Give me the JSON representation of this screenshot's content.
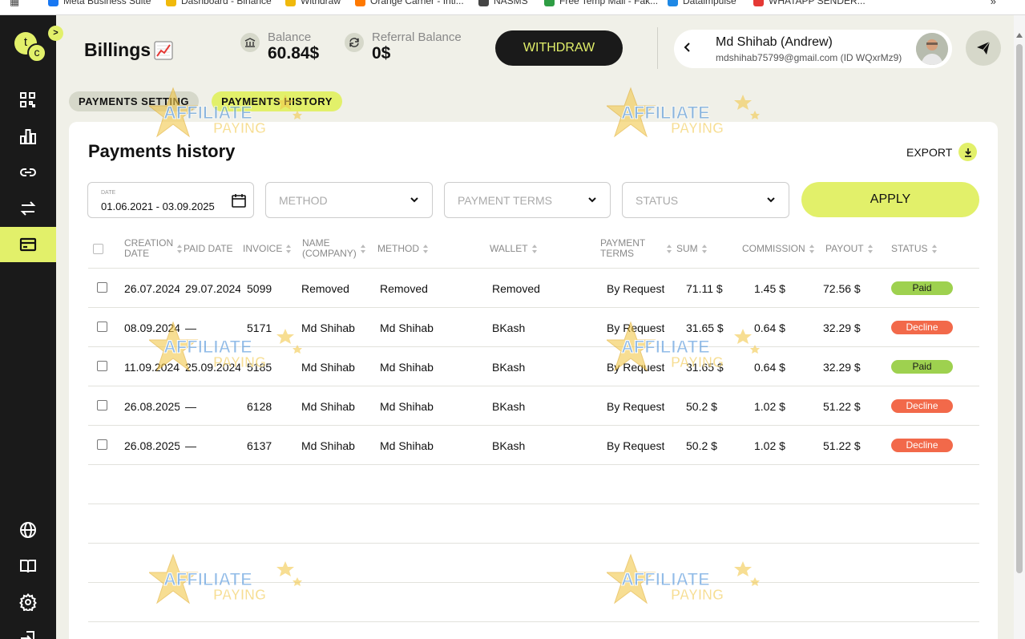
{
  "bookmarks": [
    {
      "label": "Meta Business Suite",
      "color": "#1877f2"
    },
    {
      "label": "Dashboard - Binance",
      "color": "#f0b90b"
    },
    {
      "label": "Withdraw",
      "color": "#f0b90b"
    },
    {
      "label": "Orange Carrier - Intl...",
      "color": "#ff7900"
    },
    {
      "label": "NASMS",
      "color": "#444444"
    },
    {
      "label": "Free Temp Mail - Fak...",
      "color": "#2e9d44"
    },
    {
      "label": "Dataimpulse",
      "color": "#1e88e5"
    },
    {
      "label": "WHATAPP SENDER...",
      "color": "#e53935"
    }
  ],
  "bookmarks_more": "»",
  "logo": {
    "t": "t",
    "c": "c"
  },
  "sidebar": {
    "collapse_glyph": ">",
    "items": [
      {
        "icon": "grid-icon",
        "active": false
      },
      {
        "icon": "bar-chart-icon",
        "active": false
      },
      {
        "icon": "link-icon",
        "active": false
      },
      {
        "icon": "swap-icon",
        "active": false
      },
      {
        "icon": "credit-card-icon",
        "active": true
      },
      {
        "icon": "globe-icon",
        "active": false
      },
      {
        "icon": "book-icon",
        "active": false
      },
      {
        "icon": "gear-icon",
        "active": false
      },
      {
        "icon": "logout-icon",
        "active": false
      }
    ]
  },
  "header": {
    "title": "Billings",
    "balance_label": "Balance",
    "balance_value": "60.84$",
    "referral_label": "Referral Balance",
    "referral_value": "0$",
    "withdraw_label": "WITHDRAW"
  },
  "user": {
    "name": "Md Shihab (Andrew)",
    "email": "mdshihab75799@gmail.com (ID WQxrMz9)"
  },
  "tabs": [
    {
      "label": "PAYMENTS SETTING",
      "active": false
    },
    {
      "label": "PAYMENTS HISTORY",
      "active": true
    }
  ],
  "panel": {
    "title": "Payments history",
    "export_label": "EXPORT"
  },
  "filters": {
    "date_label": "DATE",
    "date_value": "01.06.2021 - 03.09.2025",
    "method_placeholder": "METHOD",
    "terms_placeholder": "PAYMENT TERMS",
    "status_placeholder": "STATUS",
    "apply_label": "APPLY"
  },
  "table": {
    "columns": [
      {
        "label": "CREATION DATE",
        "lines": [
          "CREATION",
          "DATE"
        ],
        "sortable": true
      },
      {
        "label": "PAID DATE",
        "lines": [
          "PAID DATE"
        ],
        "sortable": false
      },
      {
        "label": "INVOICE",
        "lines": [
          "INVOICE"
        ],
        "sortable": true
      },
      {
        "label": "NAME (COMPANY)",
        "lines": [
          "NAME",
          "(COMPANY)"
        ],
        "sortable": true
      },
      {
        "label": "METHOD",
        "lines": [
          "METHOD"
        ],
        "sortable": true
      },
      {
        "label": "WALLET",
        "lines": [
          "WALLET"
        ],
        "sortable": true
      },
      {
        "label": "PAYMENT TERMS",
        "lines": [
          "PAYMENT",
          "TERMS"
        ],
        "sortable": true
      },
      {
        "label": "SUM",
        "lines": [
          "SUM"
        ],
        "sortable": true
      },
      {
        "label": "COMMISSION",
        "lines": [
          "COMMISSION"
        ],
        "sortable": true
      },
      {
        "label": "PAYOUT",
        "lines": [
          "PAYOUT"
        ],
        "sortable": true
      },
      {
        "label": "STATUS",
        "lines": [
          "STATUS"
        ],
        "sortable": true
      }
    ],
    "rows": [
      {
        "created": "26.07.2024",
        "paid": "29.07.2024",
        "invoice": "5099",
        "name": "Removed",
        "method": "Removed",
        "wallet": "Removed",
        "terms": "By Request",
        "sum": "71.11 $",
        "commission": "1.45 $",
        "payout": "72.56 $",
        "status": "Paid"
      },
      {
        "created": "08.09.2024",
        "paid": "—",
        "invoice": "5171",
        "name": "Md Shihab",
        "method": "Md Shihab",
        "wallet": "BKash",
        "terms": "By Request",
        "sum": "31.65 $",
        "commission": "0.64 $",
        "payout": "32.29 $",
        "status": "Decline"
      },
      {
        "created": "11.09.2024",
        "paid": "25.09.2024",
        "invoice": "5185",
        "name": "Md Shihab",
        "method": "Md Shihab",
        "wallet": "BKash",
        "terms": "By Request",
        "sum": "31.65 $",
        "commission": "0.64 $",
        "payout": "32.29 $",
        "status": "Paid"
      },
      {
        "created": "26.08.2025",
        "paid": "—",
        "invoice": "6128",
        "name": "Md Shihab",
        "method": "Md Shihab",
        "wallet": "BKash",
        "terms": "By Request",
        "sum": "50.2 $",
        "commission": "1.02 $",
        "payout": "51.22 $",
        "status": "Decline"
      },
      {
        "created": "26.08.2025",
        "paid": "—",
        "invoice": "6137",
        "name": "Md Shihab",
        "method": "Md Shihab",
        "wallet": "BKash",
        "terms": "By Request",
        "sum": "50.2 $",
        "commission": "1.02 $",
        "payout": "51.22 $",
        "status": "Decline"
      }
    ]
  },
  "watermark": {
    "line1": "AFFILIATE",
    "line2": "PAYING"
  },
  "colors": {
    "accent": "#e2f06a",
    "sidebar": "#1a1a1a",
    "paid": "#9ed14f",
    "decline": "#f2694a"
  }
}
